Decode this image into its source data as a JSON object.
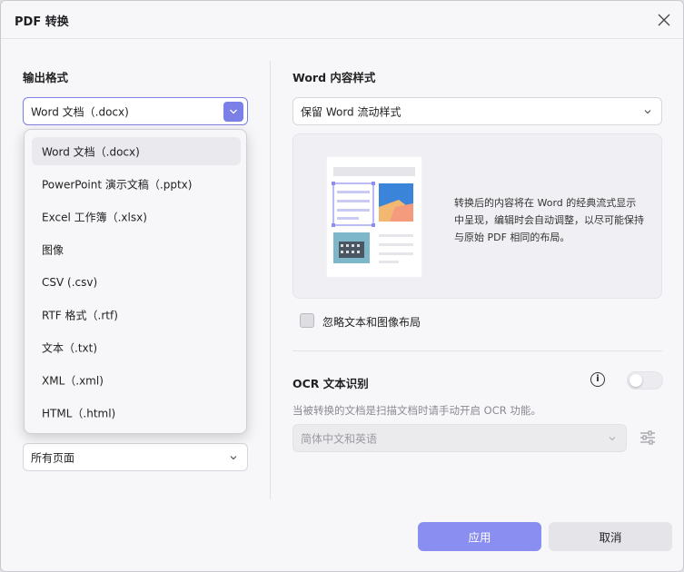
{
  "dialog": {
    "title": "PDF 转换"
  },
  "left": {
    "output_format_label": "输出格式",
    "format_select_value": "Word 文档（.docx)",
    "page_range_value": "所有页面",
    "dropdown_items": [
      "Word 文档（.docx)",
      "PowerPoint 演示文稿（.pptx)",
      "Excel 工作簿（.xlsx)",
      "图像",
      "CSV (.csv)",
      "RTF 格式（.rtf)",
      "文本（.txt)",
      "XML（.xml)",
      "HTML（.html)"
    ],
    "selected_index": 0
  },
  "right": {
    "word_style_label": "Word 内容样式",
    "word_style_value": "保留 Word 流动样式",
    "preview_description": "转换后的内容将在 Word 的经典流式显示中呈现，编辑时会自动调整，以尽可能保持与原始 PDF 相同的布局。",
    "ignore_layout_label": "忽略文本和图像布局",
    "ignore_layout_checked": false,
    "ocr_title": "OCR 文本识别",
    "ocr_enabled": false,
    "ocr_hint": "当被转换的文档是扫描文档时请手动开启 OCR 功能。",
    "ocr_language_value": "简体中文和英语"
  },
  "footer": {
    "apply_label": "应用",
    "cancel_label": "取消"
  },
  "colors": {
    "accent": "#7b80e8",
    "primary_button": "#8a8ef0"
  }
}
